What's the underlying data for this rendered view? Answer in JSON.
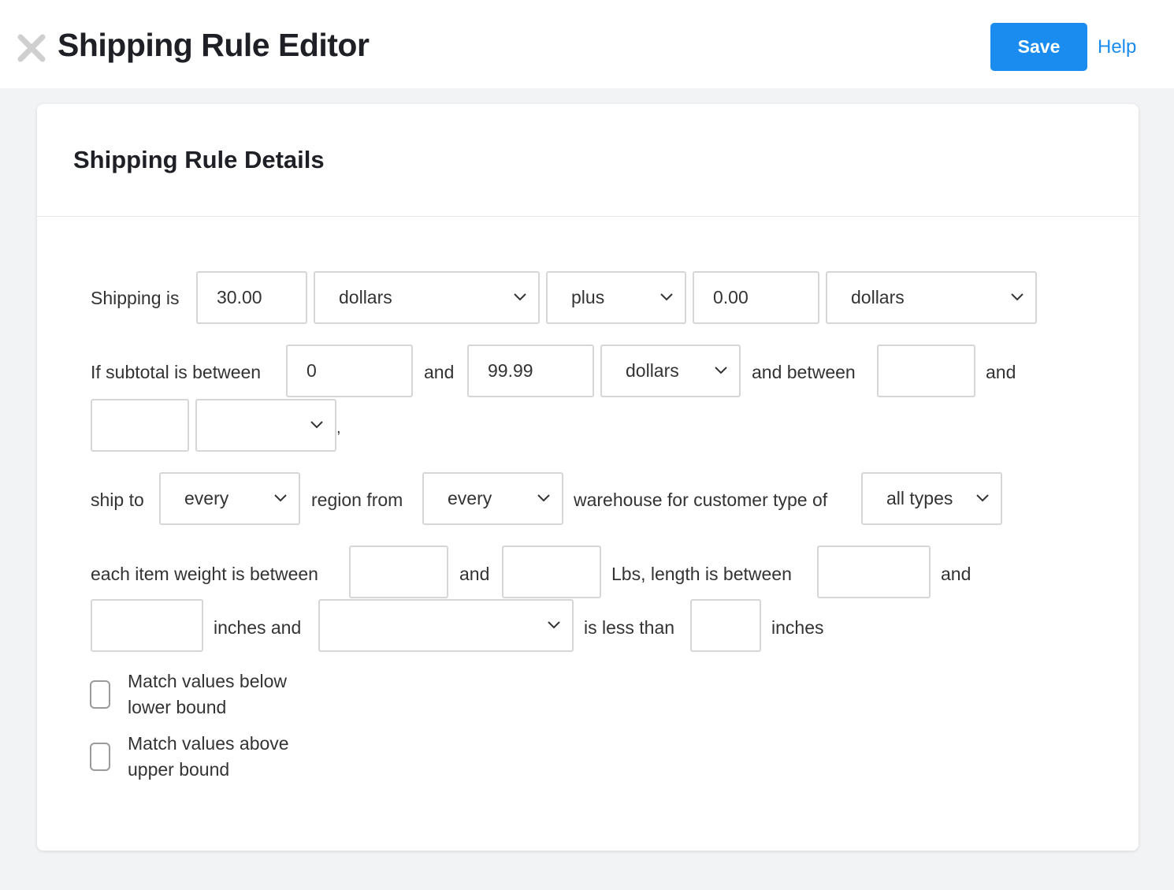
{
  "header": {
    "title": "Shipping Rule Editor",
    "save_label": "Save",
    "help_label": "Help"
  },
  "card": {
    "title": "Shipping Rule Details"
  },
  "form": {
    "shipping_is_label": "Shipping is",
    "base_amount": "30.00",
    "base_unit": "dollars",
    "operator": "plus",
    "extra_amount": "0.00",
    "extra_unit": "dollars",
    "subtotal_label": "If subtotal is between",
    "subtotal_min": "0",
    "and_label": "and",
    "subtotal_max": "99.99",
    "subtotal_unit": "dollars",
    "and_between_label": "and between",
    "second_min": "",
    "second_max": "",
    "second_unit": "",
    "comma": ",",
    "ship_to_label": "ship to",
    "region": "every",
    "region_from_label": "region from",
    "warehouse": "every",
    "warehouse_label": "warehouse for customer type of",
    "customer_type": "all types",
    "weight_label": "each item weight is between",
    "weight_min": "",
    "weight_max": "",
    "lbs_length_label": "Lbs, length is between",
    "length_min": "",
    "length_max": "",
    "inches_and_label": "inches and",
    "dimension": "",
    "less_than_label": "is less than",
    "dimension_max": "",
    "inches_label": "inches",
    "match_below": "Match values below lower bound",
    "match_above": "Match values above upper bound"
  },
  "colors": {
    "accent": "#1a8cf0",
    "background": "#f2f3f5",
    "border": "#d6d6d6"
  }
}
